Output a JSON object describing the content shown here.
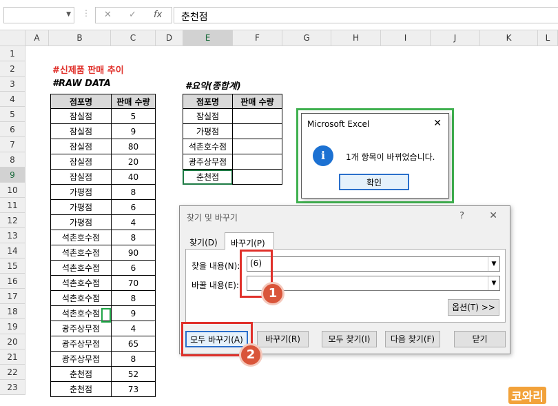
{
  "formula_bar": {
    "name_box": "",
    "cancel": "✕",
    "enter": "✓",
    "fx": "fx",
    "content": "춘천점"
  },
  "columns": [
    "A",
    "B",
    "C",
    "D",
    "E",
    "F",
    "G",
    "H",
    "I",
    "J",
    "K",
    "L"
  ],
  "rows": [
    "1",
    "2",
    "3",
    "4",
    "5",
    "6",
    "7",
    "8",
    "9",
    "10",
    "11",
    "12",
    "13",
    "14",
    "15",
    "16",
    "17",
    "18",
    "19",
    "20",
    "21",
    "22",
    "23"
  ],
  "sheet": {
    "title1": "#신제품 판매 추이",
    "title2": "#RAW DATA",
    "title3": "#요약(종합계)",
    "raw_headers": [
      "점포명",
      "판매 수량"
    ],
    "raw_rows": [
      [
        "잠실점",
        "5"
      ],
      [
        "잠실점",
        "9"
      ],
      [
        "잠실점",
        "80"
      ],
      [
        "잠실점",
        "20"
      ],
      [
        "잠실점",
        "40"
      ],
      [
        "가평점",
        "8"
      ],
      [
        "가평점",
        "6"
      ],
      [
        "가평점",
        "4"
      ],
      [
        "석촌호수점",
        "8"
      ],
      [
        "석촌호수점",
        "90"
      ],
      [
        "석촌호수점",
        "6"
      ],
      [
        "석촌호수점",
        "70"
      ],
      [
        "석촌호수점",
        "8"
      ],
      [
        "석촌호수점",
        "9"
      ],
      [
        "광주상무점",
        "4"
      ],
      [
        "광주상무점",
        "65"
      ],
      [
        "광주상무점",
        "8"
      ],
      [
        "춘천점",
        "52"
      ],
      [
        "춘천점",
        "73"
      ]
    ],
    "sum_headers": [
      "점포명",
      "판매 수량"
    ],
    "sum_rows": [
      [
        "잠실점",
        ""
      ],
      [
        "가평점",
        ""
      ],
      [
        "석촌호수점",
        ""
      ],
      [
        "광주상무점",
        ""
      ],
      [
        "춘천점",
        ""
      ]
    ]
  },
  "msgbox": {
    "title": "Microsoft Excel",
    "close": "✕",
    "icon": "i",
    "message": "1개 항목이 바뀌었습니다.",
    "ok": "확인"
  },
  "find_dialog": {
    "title": "찾기 및 바꾸기",
    "help": "?",
    "close": "✕",
    "tab_find": "찾기(D)",
    "tab_replace": "바꾸기(P)",
    "find_label": "찾을 내용(N):",
    "find_value": "(6)",
    "replace_label": "바꿀 내용(E):",
    "replace_value": "",
    "options": "옵션(T) >>",
    "replace_all": "모두 바꾸기(A)",
    "replace": "바꾸기(R)",
    "find_all": "모두 찾기(I)",
    "find_next": "다음 찾기(F)",
    "close_btn": "닫기"
  },
  "badges": [
    "1",
    "2"
  ],
  "watermark": "코와리"
}
